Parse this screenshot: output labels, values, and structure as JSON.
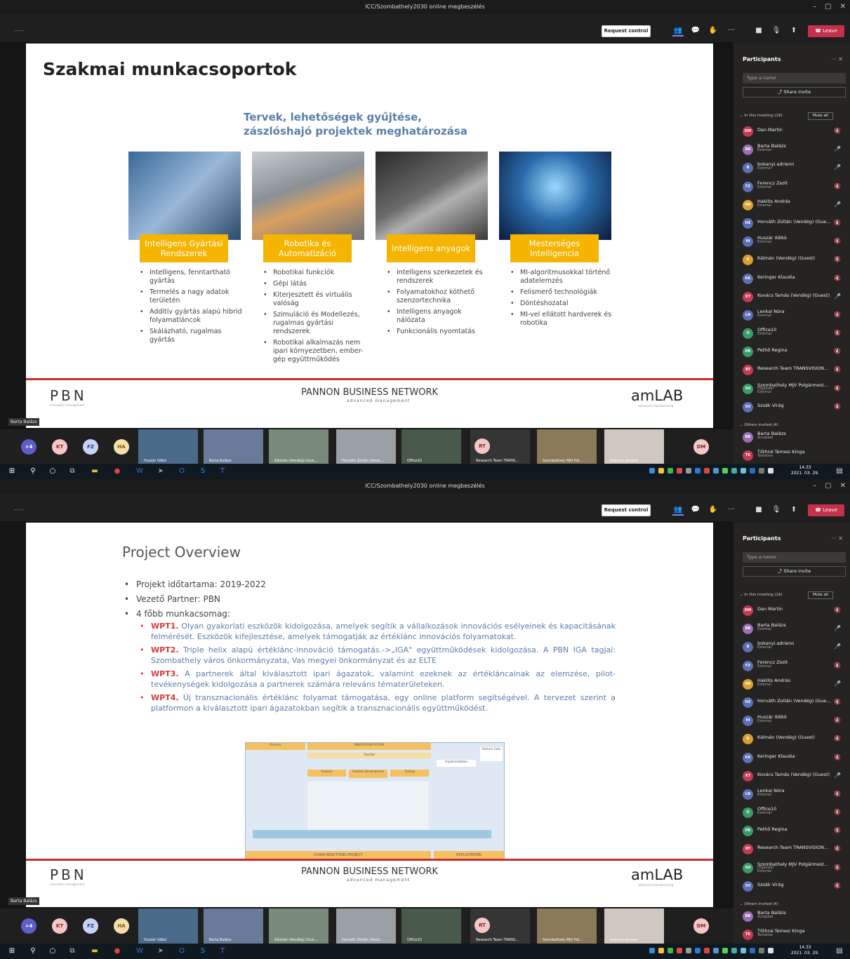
{
  "window": {
    "title": "ICC/Szombathely2030 online megbeszélés"
  },
  "toolbar": {
    "request_control": "Request control",
    "leave": "Leave",
    "dash": "–––"
  },
  "presenter_label": "Barta Balázs",
  "panel": {
    "title": "Participants",
    "search_placeholder": "Type a name",
    "share_invite": "Share invite",
    "in_meeting": "In this meeting (16)",
    "mute_all": "Mute all",
    "others_invited": "Others invited (4)",
    "participants": [
      {
        "initials": "DM",
        "name": "Dan Martin",
        "sub": "",
        "color": "#c43a55",
        "mic": "muted"
      },
      {
        "initials": "BB",
        "name": "Barta Balázs",
        "sub": "External",
        "color": "#9a6fb5",
        "mic": "on"
      },
      {
        "initials": "B",
        "name": "bokanyi.adrienn",
        "sub": "External",
        "color": "#5a6fb5",
        "mic": "on"
      },
      {
        "initials": "FZ",
        "name": "Ferencz Zsolt",
        "sub": "External",
        "color": "#5a6fb5",
        "mic": "muted"
      },
      {
        "initials": "HA",
        "name": "Haklits András",
        "sub": "External",
        "color": "#d9a030",
        "mic": "on"
      },
      {
        "initials": "HZ",
        "name": "Horváth Zoltán (Vendég) (Gue...",
        "sub": "",
        "color": "#5a6fb5",
        "mic": "muted"
      },
      {
        "initials": "HI",
        "name": "Huszár Ildikó",
        "sub": "External",
        "color": "#5a6fb5",
        "mic": "muted"
      },
      {
        "initials": "K",
        "name": "Kálmán (Vendég) (Guest)",
        "sub": "",
        "color": "#d9a030",
        "mic": "muted"
      },
      {
        "initials": "KK",
        "name": "Keringer Klaudia",
        "sub": "",
        "color": "#5a6fb5",
        "mic": "muted"
      },
      {
        "initials": "KT",
        "name": "Kovács Tamás (Vendég) (Guest)",
        "sub": "",
        "color": "#c43a55",
        "mic": "on"
      },
      {
        "initials": "LN",
        "name": "Lenkai Nóra",
        "sub": "External",
        "color": "#5a6fb5",
        "mic": "muted"
      },
      {
        "initials": "O",
        "name": "Office10",
        "sub": "External",
        "color": "#3a9a6a",
        "mic": "muted"
      },
      {
        "initials": "PR",
        "name": "Pethő Regina",
        "sub": "",
        "color": "#3a9a6a",
        "mic": "muted"
      },
      {
        "initials": "RT",
        "name": "Research Team TRANSVISION...",
        "sub": "",
        "color": "#c43a55",
        "mic": "muted"
      },
      {
        "initials": "SH",
        "name": "Szombathely MJV Polgármest...",
        "sub": "Organizer\nExternal",
        "color": "#3a9a6a",
        "mic": "muted"
      },
      {
        "initials": "SV",
        "name": "Szsák Virág",
        "sub": "",
        "color": "#5a6fb5",
        "mic": "muted"
      }
    ],
    "invited": [
      {
        "initials": "BB",
        "name": "Barta Balázs",
        "sub": "Accepted",
        "color": "#9a6fb5"
      },
      {
        "initials": "TK",
        "name": "Tőthné Temesi Kinga",
        "sub": "Tentative",
        "color": "#c43a55"
      }
    ]
  },
  "strip": {
    "bubbles": [
      {
        "label": "+4",
        "color": "#5b5fc7",
        "text": "#fff"
      },
      {
        "label": "KT",
        "color": "#f4c7c7",
        "text": "#7a2a2a"
      },
      {
        "label": "FZ",
        "color": "#c7d3f4",
        "text": "#2a3a7a"
      },
      {
        "label": "HA",
        "color": "#f4dfa8",
        "text": "#7a5a1a"
      }
    ],
    "videos": [
      "Huszár Ildikó",
      "Barta Balázs",
      "Kálmán (Vendég) (Gue...",
      "Horváth Zoltán (Vend...",
      "Office10",
      "Research Team TRANS...",
      "Szombathely MJV Pol...",
      "bokanyi.adrienn"
    ],
    "dm": "DM",
    "rt": "RT"
  },
  "taskbar": {
    "time": "14:33",
    "date": "2021. 03. 29."
  },
  "slide1": {
    "title": "Szakmai munkacsoportok",
    "subtitle1": "Tervek, lehetőségek gyűjtése,",
    "subtitle2": "zászlóshajó projektek meghatározása",
    "columns": [
      {
        "tag": "Intelligens Gyártási Rendszerek",
        "items": [
          "Intelligens, fenntartható gyártás",
          "Termelés a nagy adatok területén",
          "Additív gyártás alapú hibrid folyamatláncok",
          "Skálázható, rugalmas gyártás"
        ]
      },
      {
        "tag": "Robotika és Automatizáció",
        "items": [
          "Robotikai funkciók",
          "Gépi látás",
          "Kiterjesztett és virtuális valóság",
          "Szimuláció és Modellezés, rugalmas gyártási rendszerek",
          "Robotikai alkalmazás nem ipari környezetben, ember-gép együttműködés"
        ]
      },
      {
        "tag": "Intelligens anyagok",
        "items": [
          "Intelligens szerkezetek és rendszerek",
          "Folyamatokhoz köthető szenzortechnika",
          "Intelligens anyagok nálózata",
          "Funkcionális nyomtatás"
        ]
      },
      {
        "tag": "Mesterséges Intelligencia",
        "items": [
          "MI-algoritmusokkal történő adatelemzés",
          "Felismerő technológiák",
          "Döntéshozatal",
          "MI-vel ellátott hardverek és robotika"
        ]
      }
    ]
  },
  "footer": {
    "pbn": "PBN",
    "pbn_sub": "innovation management",
    "pannon": "PANNON BUSINESS NETWORK",
    "pannon_sub": "advanced management",
    "amlab": "amLAB",
    "amlab_sub": "advanced manufacturing"
  },
  "slide2": {
    "title": "Project Overview",
    "bullets": [
      "Projekt időtartama: 2019-2022",
      "Vezető Partner: PBN",
      "4 főbb munkacsomag:"
    ],
    "wps": [
      {
        "code": "WPT1.",
        "text": " Olyan gyakorlati eszközök kidolgozása, amelyek segítik a vállalkozások innovációs esélyeinek és kapacitásának felmérését. Eszközök kifejlesztése, amelyek támogatják az értéklánc innovációs folyamatokat."
      },
      {
        "code": "WPT2.",
        "text": " Triple helix alapú értéklánc-innováció támogatás.->„IGA\" együttműködések kidolgozása. A PBN IGA tagjai: Szombathely város önkormányzata, Vas megyei önkormányzat és az ELTE"
      },
      {
        "code": "WPT3.",
        "text": " A partnerek által kiválasztott ipari ágazatok, valamint ezeknek az értékláncainak az elemzése, pilot-tevékenységek kidolgozása a partnerek számára releváns tématerületeken."
      },
      {
        "code": "WPT4.",
        "text": " Új transznacionális értéklánc folyamat támogatása, egy online platform segítségével. A tervezet szerint a platformon a kiválasztott ipari ágazatokban segítik a transznacionális együttműködést."
      }
    ],
    "diagram": {
      "partners": "Partners",
      "innovation": "INNOVATION SYSTEM",
      "transfer": "Transfer",
      "analysis": "Analysis",
      "ideation": "Ideation Development",
      "testing": "Testing",
      "venture": "Venture Gate",
      "implementation": "Implementation",
      "chain": "CHAIN REACTIONS PROJECT",
      "exploitation": "EXPLOITATION"
    }
  }
}
